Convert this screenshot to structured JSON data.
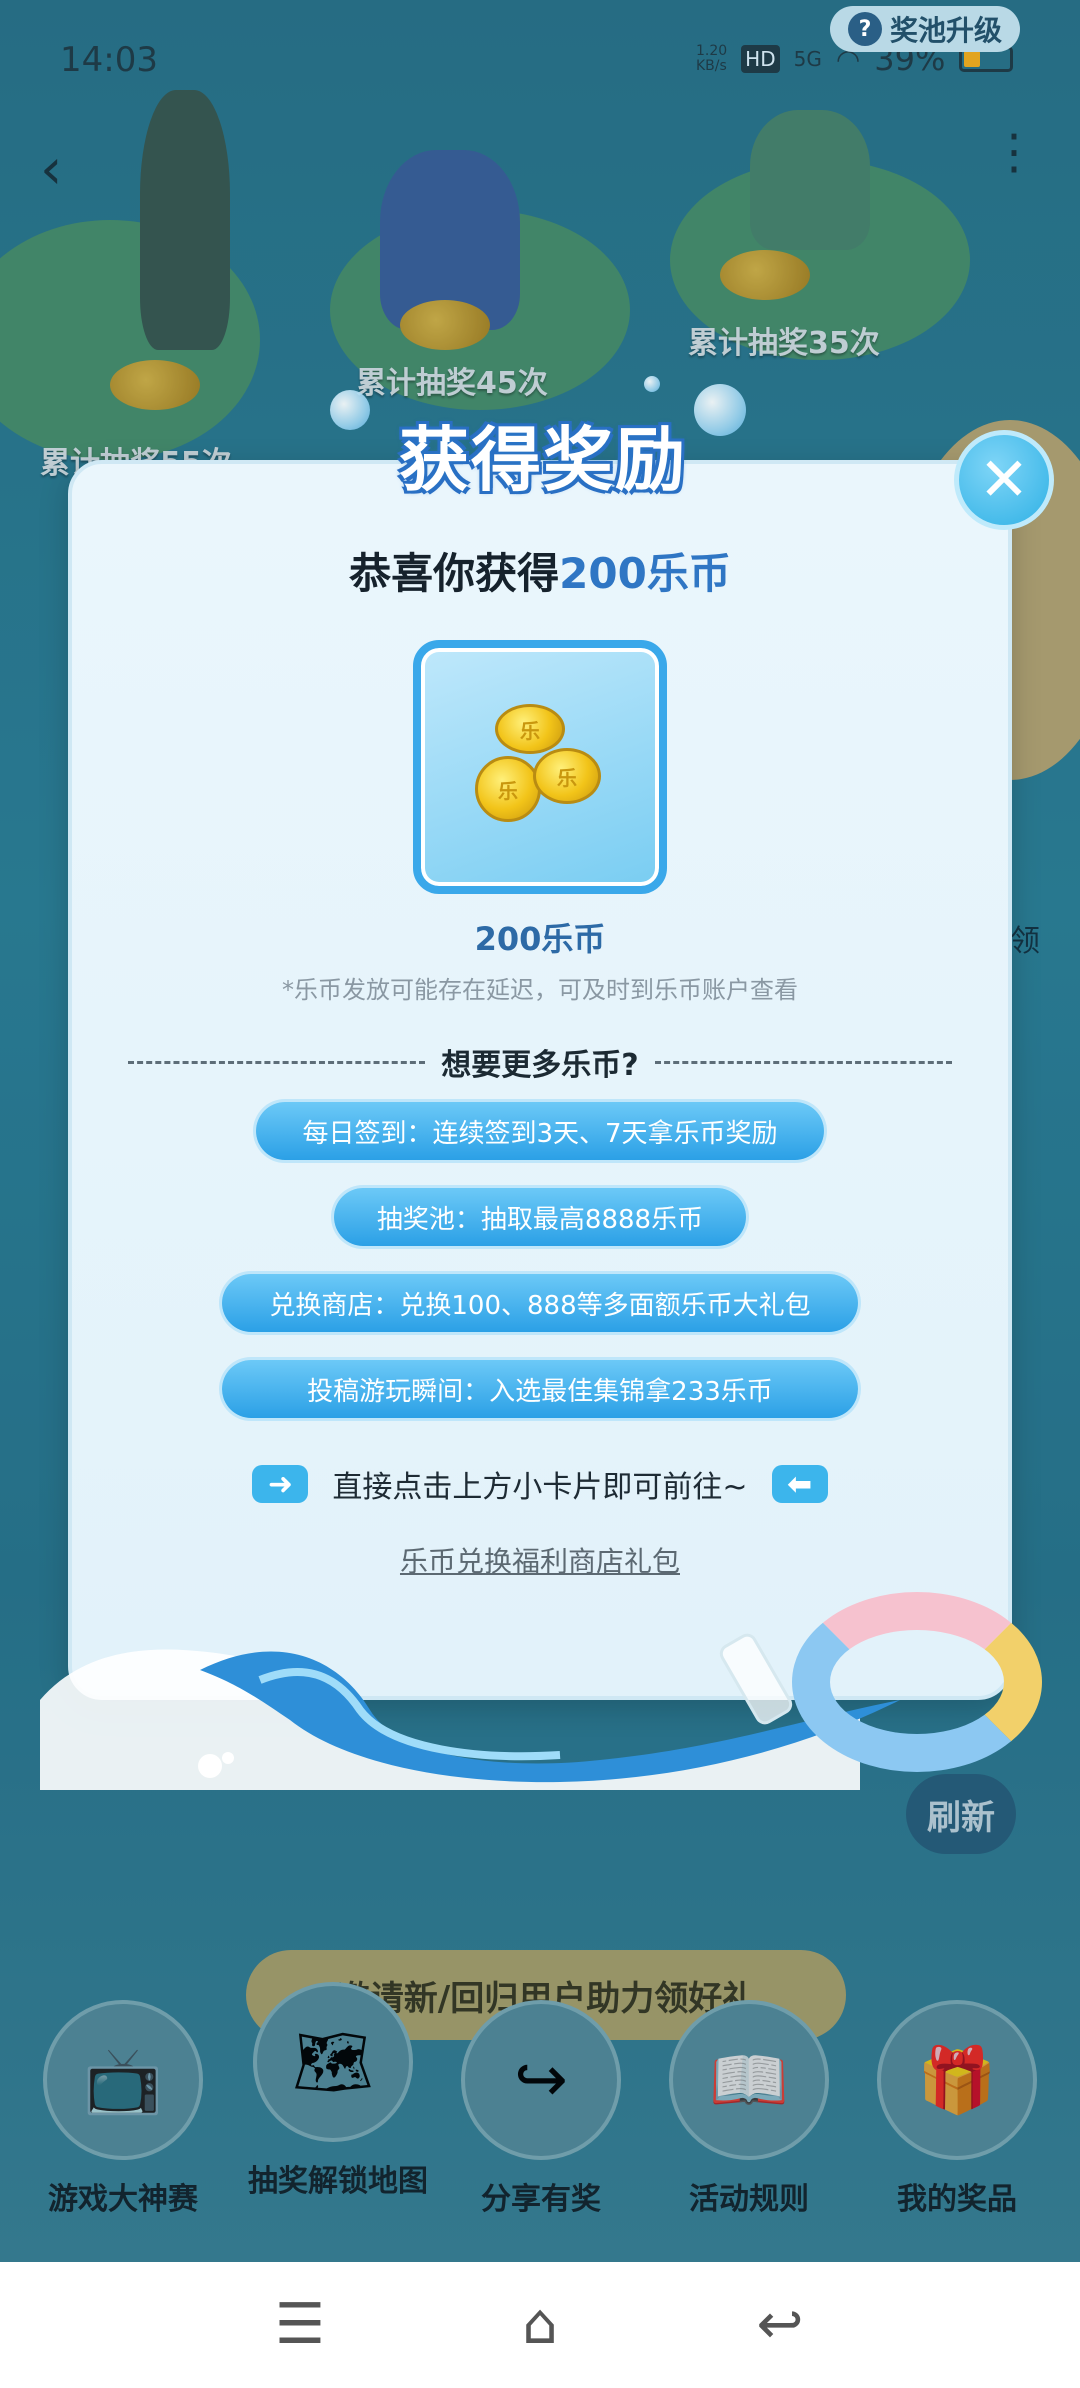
{
  "status_bar": {
    "time": "14:03",
    "net_speed": "1.20\nKB/s",
    "hd": "HD",
    "signal": "5G",
    "battery": "39%"
  },
  "scene": {
    "pool_upgrade": "奖池升级",
    "milestones": [
      "累计抽奖55次",
      "累计抽奖45次",
      "累计抽奖35次"
    ],
    "side_text": "领",
    "refresh_label": "刷新",
    "helper_banner": "邀请新/回归用户助力领好礼",
    "bottom_nav": [
      {
        "label": "游戏大神赛",
        "icon": "tv-icon"
      },
      {
        "label": "抽奖解锁地图",
        "icon": "map-icon"
      },
      {
        "label": "分享有奖",
        "icon": "share-icon"
      },
      {
        "label": "活动规则",
        "icon": "book-icon"
      },
      {
        "label": "我的奖品",
        "icon": "gift-icon"
      }
    ]
  },
  "modal": {
    "title": "获得奖励",
    "congrats_prefix": "恭喜你获得",
    "congrats_amount": "200乐币",
    "reward_name": "200乐币",
    "reward_note": "*乐币发放可能存在延迟，可及时到乐币账户查看",
    "divider_text": "想要更多乐币?",
    "options": [
      "每日签到：连续签到3天、7天拿乐币奖励",
      "抽奖池：抽取最高8888乐币",
      "兑换商店：兑换100、888等多面额乐币大礼包",
      "投稿游玩瞬间：入选最佳集锦拿233乐币"
    ],
    "hint": "直接点击上方小卡片即可前往~",
    "shop_link": "乐币兑换福利商店礼包",
    "coin_glyph": "乐"
  },
  "colors": {
    "accent": "#2f76c4",
    "pill": "#2ba0e6",
    "close": "#2fb1e5"
  }
}
